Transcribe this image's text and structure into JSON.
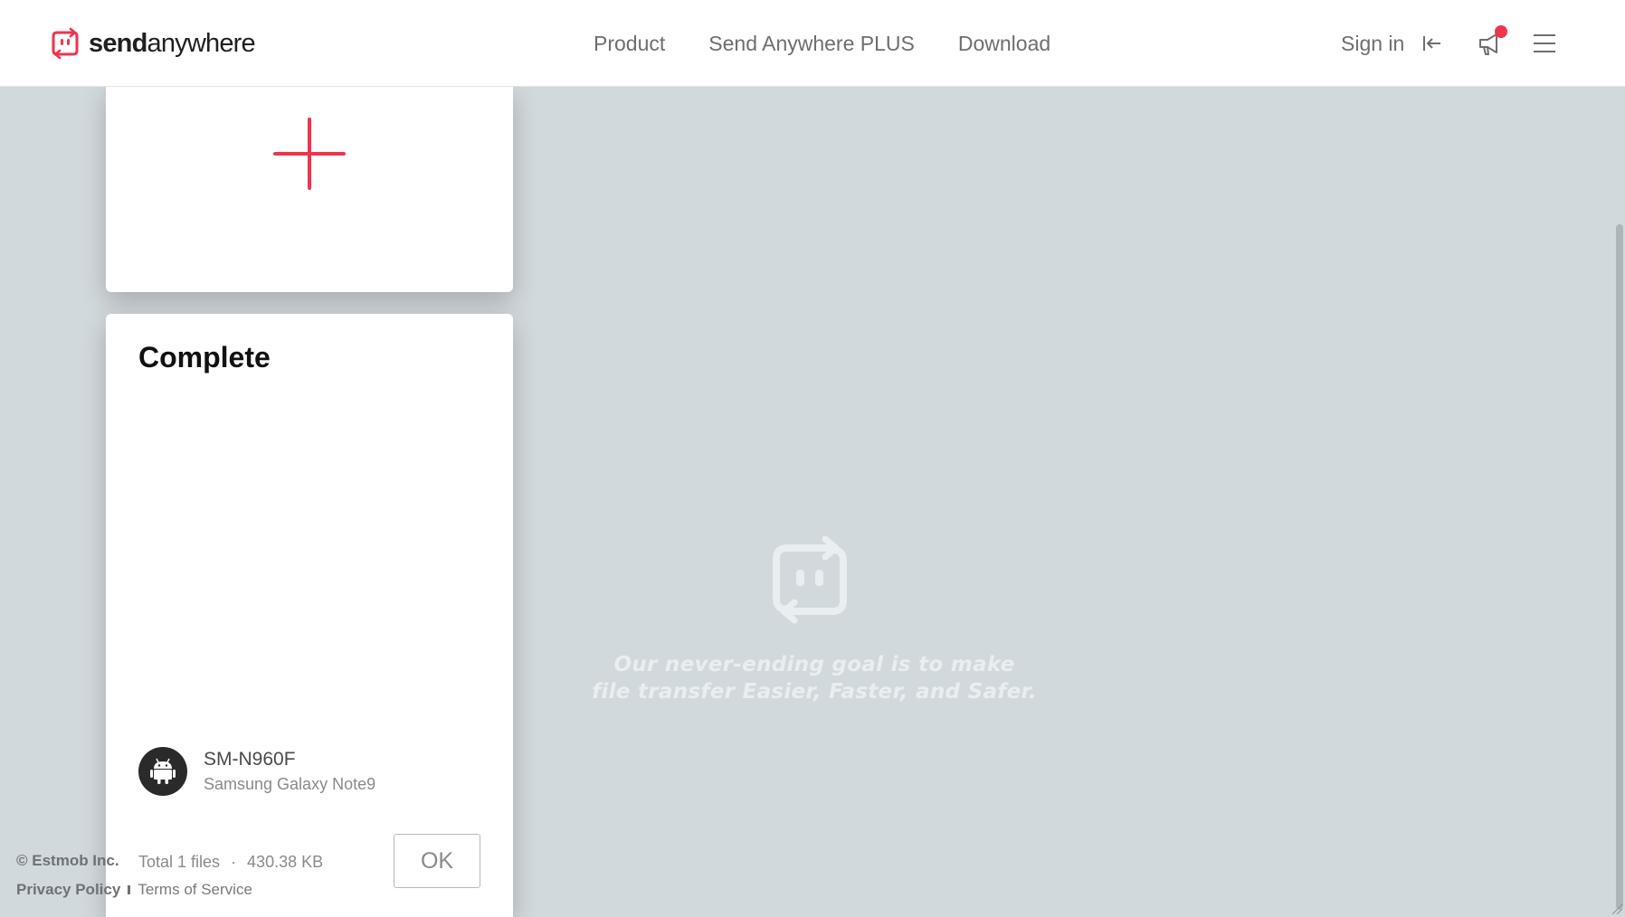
{
  "header": {
    "logo_bold": "send",
    "logo_light": "anywhere",
    "nav": [
      "Product",
      "Send Anywhere PLUS",
      "Download"
    ],
    "sign_in": "Sign in",
    "notification_icon": "megaphone-icon",
    "menu_icon": "hamburger-icon"
  },
  "upload_card": {
    "add_icon": "plus-icon"
  },
  "complete_card": {
    "title": "Complete",
    "device_icon": "android-icon",
    "device_name": "SM-N960F",
    "device_model": "Samsung Galaxy Note9",
    "total_files": "Total 1 files",
    "separator": "·",
    "total_size": "430.38 KB",
    "ok_label": "OK"
  },
  "tagline": {
    "line1": "Our never-ending goal is to make",
    "line2": "file transfer Easier, Faster, and Safer."
  },
  "footer": {
    "copyright": "© Estmob Inc.",
    "privacy": "Privacy Policy",
    "terms": "Terms of Service"
  },
  "colors": {
    "brand": "#f2334c",
    "background": "#d2d9dd",
    "card": "#ffffff"
  }
}
